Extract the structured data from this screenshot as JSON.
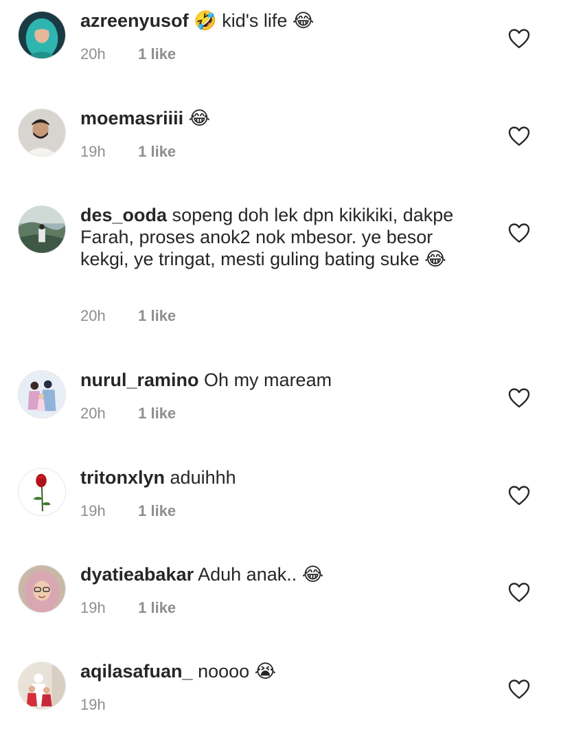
{
  "comments": [
    {
      "username": "azreenyusof",
      "text": "🤣 kid's life 😂",
      "time": "20h",
      "likes": "1 like"
    },
    {
      "username": "moemasriiii",
      "text": "😂",
      "time": "19h",
      "likes": "1 like"
    },
    {
      "username": "des_ooda",
      "text": "sopeng doh lek dpn kikikiki, dakpe Farah, proses anok2 nok mbesor. ye besor kekgi, ye tringat, mesti guling bating suke 😂",
      "time": "20h",
      "likes": "1 like"
    },
    {
      "username": "nurul_ramino",
      "text": "Oh my maream",
      "time": "20h",
      "likes": "1 like"
    },
    {
      "username": "tritonxlyn",
      "text": "aduihhh",
      "time": "19h",
      "likes": "1 like"
    },
    {
      "username": "dyatieabakar",
      "text": "Aduh anak.. 😂",
      "time": "19h",
      "likes": "1 like"
    },
    {
      "username": "aqilasafuan_",
      "text": "noooo 😭",
      "time": "19h",
      "likes": ""
    }
  ],
  "icons": {
    "like": "heart-outline-icon",
    "avatar": "user-avatar"
  },
  "colors": {
    "text": "#262626",
    "meta": "#8e8e8e",
    "background": "#ffffff"
  }
}
